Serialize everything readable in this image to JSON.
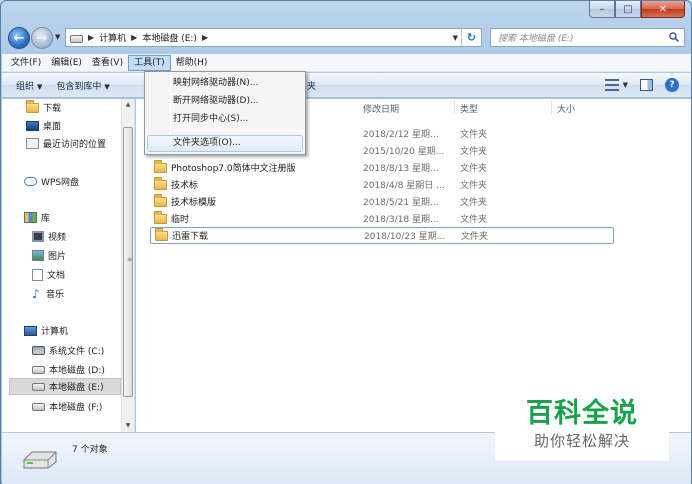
{
  "window": {
    "caption_buttons": [
      "–",
      "□",
      "✕"
    ]
  },
  "address": {
    "segments": [
      "计算机",
      "本地磁盘 (E:)"
    ],
    "search_placeholder": "搜索 本地磁盘 (E:)"
  },
  "menubar": {
    "items": [
      "文件(F)",
      "编辑(E)",
      "查看(V)",
      "工具(T)",
      "帮助(H)"
    ],
    "open_index": 3
  },
  "toolbar": {
    "organize": "组织",
    "include_library": "包含到库中",
    "trailing": "夹"
  },
  "tools_menu": {
    "items": [
      "映射网络驱动器(N)...",
      "断开网络驱动器(D)...",
      "打开同步中心(S)...",
      "文件夹选项(O)..."
    ],
    "hover_index": 3
  },
  "navpane": {
    "items": [
      {
        "label": "下载",
        "icon": "folder-icon"
      },
      {
        "label": "桌面",
        "icon": "desktop-icon"
      },
      {
        "label": "最近访问的位置",
        "icon": "recent-places-icon"
      },
      {
        "label": "WPS网盘",
        "icon": "cloud-icon"
      },
      {
        "label": "库",
        "icon": "library-icon"
      },
      {
        "label": "视频",
        "icon": "video-icon"
      },
      {
        "label": "图片",
        "icon": "pictures-icon"
      },
      {
        "label": "文档",
        "icon": "documents-icon"
      },
      {
        "label": "音乐",
        "icon": "music-icon"
      },
      {
        "label": "计算机",
        "icon": "computer-icon"
      },
      {
        "label": "系统文件 (C:)",
        "icon": "system-drive-icon"
      },
      {
        "label": "本地磁盘 (D:)",
        "icon": "drive-icon"
      },
      {
        "label": "本地磁盘 (E:)",
        "icon": "drive-icon",
        "selected": true
      },
      {
        "label": "本地磁盘 (F:)",
        "icon": "drive-icon"
      }
    ]
  },
  "columns": {
    "date": "修改日期",
    "type": "类型",
    "size": "大小"
  },
  "files": [
    {
      "name": "",
      "date": "2018/2/12 星期...",
      "type": "文件夹"
    },
    {
      "name": "",
      "date": "2015/10/20 星期...",
      "type": "文件夹"
    },
    {
      "name": "Photoshop7.0简体中文注册版",
      "date": "2018/8/13 星期...",
      "type": "文件夹"
    },
    {
      "name": "技术标",
      "date": "2018/4/8 星期日 ...",
      "type": "文件夹"
    },
    {
      "name": "技术标模版",
      "date": "2018/5/21 星期...",
      "type": "文件夹"
    },
    {
      "name": "临时",
      "date": "2018/3/18 星期...",
      "type": "文件夹"
    },
    {
      "name": "迅雷下载",
      "date": "2018/10/23 星期...",
      "type": "文件夹",
      "focused": true
    }
  ],
  "status": {
    "count": "7 个对象"
  },
  "watermark": {
    "title": "百科全说",
    "subtitle": "助你轻松解决"
  },
  "colors": {
    "watermark_green": "#16a34a",
    "selection_blue": "#7da2ce"
  }
}
